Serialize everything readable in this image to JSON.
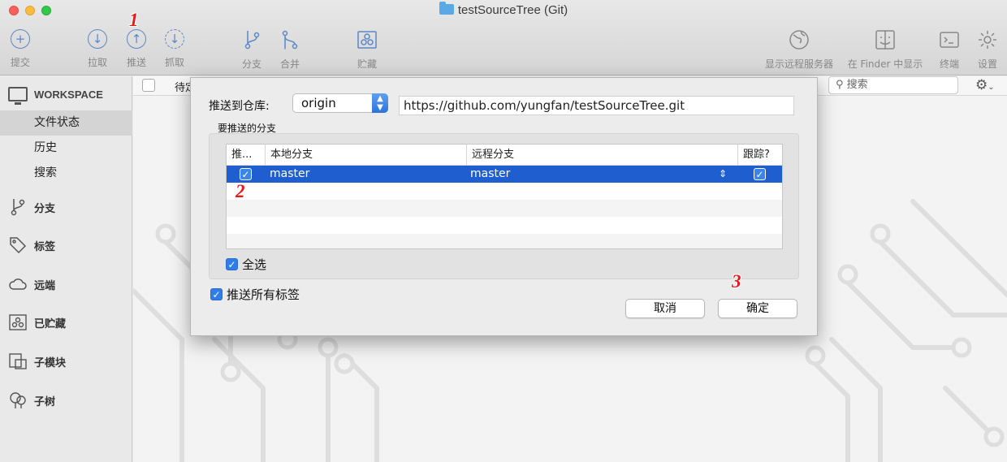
{
  "window": {
    "title": "testSourceTree (Git)"
  },
  "toolbar": {
    "commit": "提交",
    "pull": "拉取",
    "push": "推送",
    "fetch": "抓取",
    "branch": "分支",
    "merge": "合并",
    "stash": "贮藏",
    "show_remote": "显示远程服务器",
    "show_in_finder": "在 Finder 中显示",
    "terminal": "终端",
    "settings": "设置"
  },
  "annotations": {
    "step1": "1",
    "step2": "2",
    "step3": "3"
  },
  "sidebar": {
    "workspace": "WORKSPACE",
    "file_status": "文件状态",
    "history": "历史",
    "search": "搜索",
    "branches": "分支",
    "tags": "标签",
    "remotes": "远端",
    "stashes": "已贮藏",
    "submodules": "子模块",
    "subtrees": "子树"
  },
  "main": {
    "pending_label": "待定",
    "search_placeholder": "搜索"
  },
  "dialog": {
    "push_to_repo_label": "推送到仓库:",
    "repo_selected": "origin",
    "repo_url": "https://github.com/yungfan/testSourceTree.git",
    "branches_label": "要推送的分支",
    "columns": {
      "push": "推...",
      "local": "本地分支",
      "remote": "远程分支",
      "track": "跟踪?"
    },
    "rows": [
      {
        "push": true,
        "local": "master",
        "remote": "master",
        "track": true
      }
    ],
    "select_all": "全选",
    "push_all_tags": "推送所有标签",
    "cancel": "取消",
    "ok": "确定"
  },
  "colors": {
    "accent": "#1e5ecf",
    "annotation": "#e21b1b",
    "toolbar_icon": "#5b87c7"
  }
}
